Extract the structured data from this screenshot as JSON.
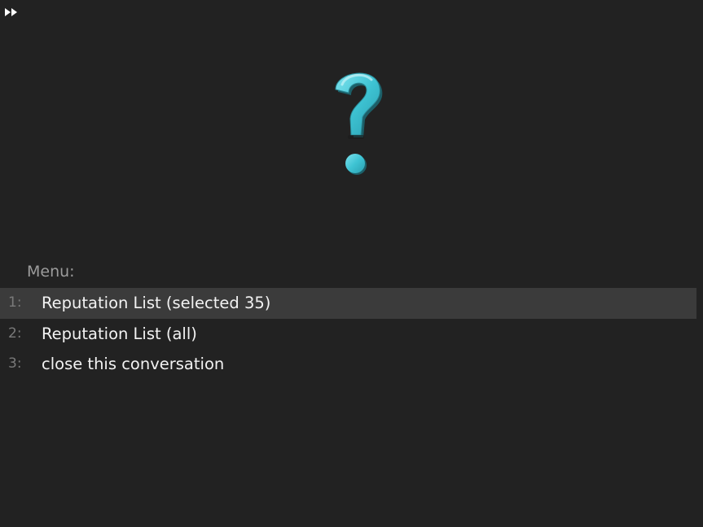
{
  "toolbar": {
    "fast_forward_icon": "fast-forward-icon"
  },
  "portrait": {
    "icon": "question-mark-icon",
    "color": "#3ec3d3"
  },
  "menu": {
    "header": "Menu:",
    "items": [
      {
        "number": "1:",
        "label": "Reputation List (selected 35)",
        "selected": true
      },
      {
        "number": "2:",
        "label": "Reputation List (all)",
        "selected": false
      },
      {
        "number": "3:",
        "label": "close this conversation",
        "selected": false
      }
    ]
  },
  "colors": {
    "background": "#222222",
    "selected_row": "#3b3b3b",
    "accent": "#3ec3d3"
  }
}
